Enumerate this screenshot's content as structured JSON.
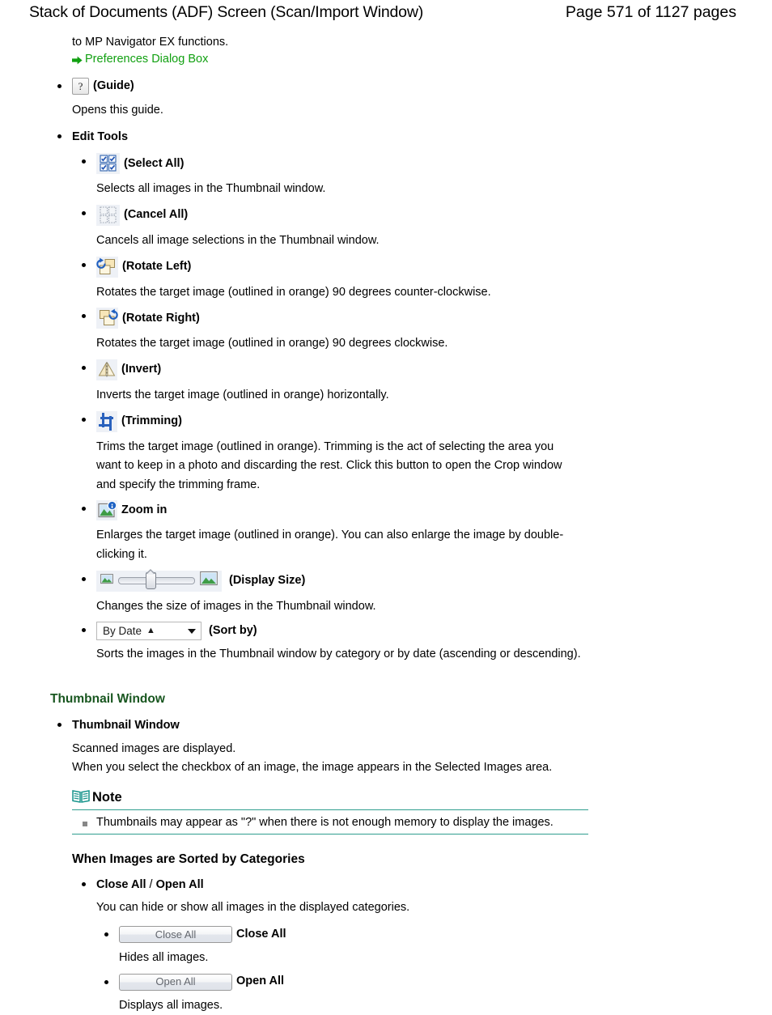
{
  "header": {
    "doc_title": "Stack of Documents (ADF) Screen (Scan/Import Window)",
    "page_number": "Page 571 of 1127 pages"
  },
  "intro": {
    "text": "to MP Navigator EX functions.",
    "link_label": "Preferences Dialog Box",
    "link_icon": "green-arrow-icon",
    "link_color": "#11a011"
  },
  "guide": {
    "icon_glyph": "?",
    "icon_name": "question-mark-icon",
    "label": "(Guide)",
    "description": "Opens this guide."
  },
  "edit_tools": {
    "heading": "Edit Tools",
    "items": [
      {
        "icon": "select-all-icon",
        "label": "(Select All)",
        "description": "Selects all images in the Thumbnail window."
      },
      {
        "icon": "cancel-all-icon",
        "label": "(Cancel All)",
        "description": "Cancels all image selections in the Thumbnail window."
      },
      {
        "icon": "rotate-left-icon",
        "label": "(Rotate Left)",
        "description": "Rotates the target image (outlined in orange) 90 degrees counter-clockwise."
      },
      {
        "icon": "rotate-right-icon",
        "label": "(Rotate Right)",
        "description": "Rotates the target image (outlined in orange) 90 degrees clockwise."
      },
      {
        "icon": "invert-icon",
        "label": "(Invert)",
        "description": "Inverts the target image (outlined in orange) horizontally."
      },
      {
        "icon": "trimming-icon",
        "label": "(Trimming)",
        "description": "Trims the target image (outlined in orange). Trimming is the act of selecting the area you want to keep in a photo and discarding the rest. Click this button to open the Crop window and specify the trimming frame."
      },
      {
        "icon": "zoom-in-icon",
        "label": "Zoom in",
        "description": "Enlarges the target image (outlined in orange). You can also enlarge the image by double-clicking it."
      },
      {
        "icon": "display-size-slider",
        "label": "(Display Size)",
        "description": "Changes the size of images in the Thumbnail window."
      },
      {
        "icon": "sort-by-combobox",
        "label": "(Sort by)",
        "description": "Sorts the images in the Thumbnail window by category or by date (ascending or descending)."
      }
    ],
    "sort_by": {
      "value": "By Date",
      "ascending_glyph": "▲",
      "dropdown_icon": "chevron-down-icon"
    }
  },
  "thumbnail_window": {
    "section_heading": "Thumbnail Window",
    "section_heading_color": "#18561f",
    "item_label": "Thumbnail Window",
    "description_line1": "Scanned images are displayed.",
    "description_line2": "When you select the checkbox of an image, the image appears in the Selected Images area."
  },
  "note": {
    "icon": "open-book-icon",
    "title": "Note",
    "rule_color": "#2f9e8f",
    "items": [
      "Thumbnails may appear as \"?\" when there is not enough memory to display the images."
    ]
  },
  "categories_section": {
    "heading": "When Images are Sorted by Categories",
    "item_bold_a": "Close All",
    "item_sep": " / ",
    "item_bold_b": "Open All",
    "item_description": "You can hide or show all images in the displayed categories.",
    "buttons": [
      {
        "button_text": "Close All",
        "label": "Close All",
        "description": "Hides all images."
      },
      {
        "button_text": "Open All",
        "label": "Open All",
        "description": "Displays all images."
      }
    ]
  }
}
